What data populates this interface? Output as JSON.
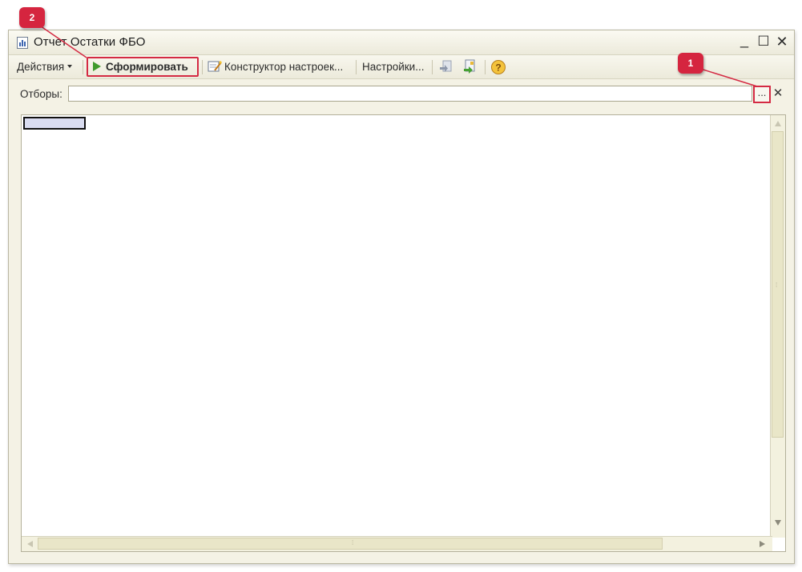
{
  "window": {
    "title": "Отчет  Остатки ФБО",
    "controls": {
      "minimize": "_",
      "maximize": "☐",
      "close": "✕"
    }
  },
  "toolbar": {
    "actions_label": "Действия",
    "generate_label": "Сформировать",
    "constructor_label": "Конструктор настроек...",
    "settings_label": "Настройки..."
  },
  "filter": {
    "label": "Отборы:",
    "value": "",
    "select_button": "...",
    "clear_button": "✕"
  },
  "callouts": [
    {
      "label": "1"
    },
    {
      "label": "2"
    }
  ],
  "colors": {
    "highlight": "#d42a43",
    "callout": "#d5253f",
    "play": "#3f9a2c"
  }
}
